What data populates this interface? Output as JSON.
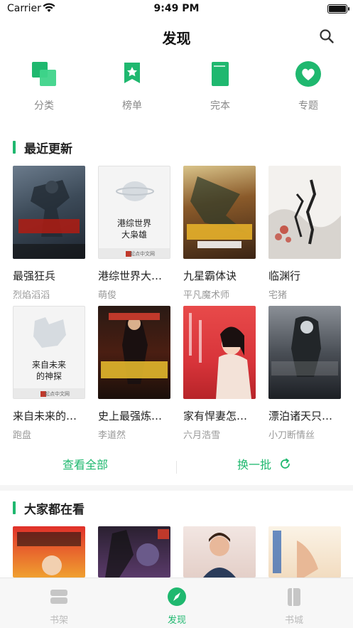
{
  "status_bar": {
    "carrier": "Carrier",
    "time": "9:49 PM"
  },
  "nav": {
    "title": "发现"
  },
  "categories": [
    {
      "label": "分类",
      "icon": "category-icon"
    },
    {
      "label": "榜单",
      "icon": "ranking-icon"
    },
    {
      "label": "完本",
      "icon": "finished-book-icon"
    },
    {
      "label": "专题",
      "icon": "topic-heart-icon"
    }
  ],
  "recent": {
    "title": "最近更新",
    "books": [
      {
        "name": "最强狂兵",
        "author": "烈焰滔滔"
      },
      {
        "name": "港综世界大枭雄",
        "author": "萌俊",
        "cover_text": "港综世界大枭雄",
        "cover_brand": "起点中文网"
      },
      {
        "name": "九星霸体诀",
        "author": "平凡魔术师"
      },
      {
        "name": "临渊行",
        "author": "宅猪"
      },
      {
        "name": "来自未来的神探",
        "author": "跑盘",
        "cover_text": "来自未来的神探",
        "cover_brand": "起点中文网"
      },
      {
        "name": "史上最强炼气期",
        "author": "李道然"
      },
      {
        "name": "家有悍妻怎么破",
        "author": "六月浩雪"
      },
      {
        "name": "漂泊诸天只求生",
        "author": "小刀断情丝"
      }
    ],
    "view_all": "查看全部",
    "refresh": "换一批"
  },
  "popular": {
    "title": "大家都在看"
  },
  "tabbar": {
    "tabs": [
      {
        "label": "书架"
      },
      {
        "label": "发现"
      },
      {
        "label": "书城"
      }
    ],
    "active_index": 1
  },
  "colors": {
    "accent": "#1fb86f"
  }
}
